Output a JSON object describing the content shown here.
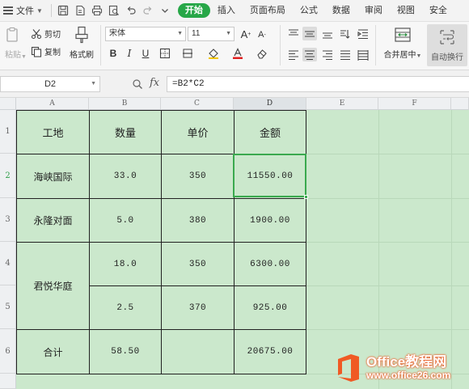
{
  "menubar": {
    "file_label": "文件",
    "tabs": [
      {
        "label": "开始",
        "active": true
      },
      {
        "label": "插入",
        "active": false
      },
      {
        "label": "页面布局",
        "active": false
      },
      {
        "label": "公式",
        "active": false
      },
      {
        "label": "数据",
        "active": false
      },
      {
        "label": "审阅",
        "active": false
      },
      {
        "label": "视图",
        "active": false
      },
      {
        "label": "安全",
        "active": false
      }
    ]
  },
  "ribbon": {
    "paste_label": "粘贴",
    "cut_label": "剪切",
    "copy_label": "复制",
    "format_painter_label": "格式刷",
    "font_name": "宋体",
    "font_size": "11",
    "bold": "B",
    "italic": "I",
    "underline": "U",
    "font_grow": "A",
    "font_shrink": "A",
    "merge_center_label": "合并居中",
    "wrap_text_label": "自动换行"
  },
  "formula_bar": {
    "name_box": "D2",
    "fx": "fx",
    "formula": "=B2*C2"
  },
  "sheet": {
    "columns": [
      "A",
      "B",
      "C",
      "D",
      "E",
      "F"
    ],
    "rows": [
      "1",
      "2",
      "3",
      "4",
      "5",
      "6"
    ],
    "selected_cell": "D2",
    "header": [
      "工地",
      "数量",
      "单价",
      "金额"
    ],
    "cells": {
      "a2": "海峡国际",
      "b2": "33.0",
      "c2": "350",
      "d2": "11550.00",
      "a3": "永隆对面",
      "b3": "5.0",
      "c3": "380",
      "d3": "1900.00",
      "a45": "君悦华庭",
      "b4": "18.0",
      "c4": "350",
      "d4": "6300.00",
      "b5": "2.5",
      "c5": "370",
      "d5": "925.00",
      "a6": "合计",
      "b6": "58.50",
      "c6": "",
      "d6": "20675.00"
    },
    "fill_color": "#cbe8cc",
    "selection_color": "#3aa94e"
  },
  "watermark": {
    "line1": "Office教程网",
    "line2": "www.office26.com",
    "color": "#f05a24"
  }
}
